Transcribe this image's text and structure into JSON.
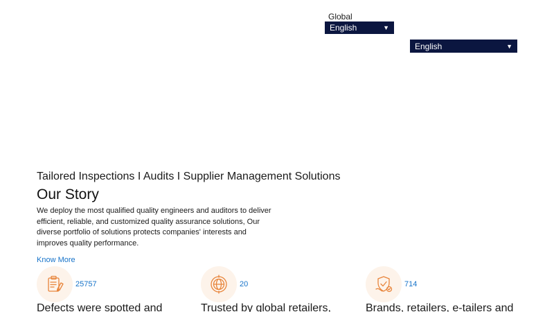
{
  "header": {
    "region_label": "Global",
    "language_select_primary": "English",
    "language_select_secondary": "English"
  },
  "hero": {
    "tagline": "Tailored Inspections I Audits I Supplier Management Solutions",
    "title": "Our Story",
    "description": "We deploy the most qualified quality engineers and auditors to deliver efficient, reliable, and customized quality assurance solutions, Our diverse portfolio of solutions protects companies' interests and improves quality performance.",
    "cta_label": "Know More"
  },
  "stats": [
    {
      "icon": "clipboard-check-icon",
      "value": "25757",
      "caption": "Defects were spotted and"
    },
    {
      "icon": "globe-icon",
      "value": "20",
      "caption": "Trusted by global retailers,"
    },
    {
      "icon": "shield-check-icon",
      "value": "714",
      "caption": "Brands, retailers, e-tailers and"
    }
  ],
  "colors": {
    "select_background": "#0b1640",
    "link": "#1673c9",
    "icon_accent": "#e8843a",
    "icon_background": "#fdf3ea"
  }
}
